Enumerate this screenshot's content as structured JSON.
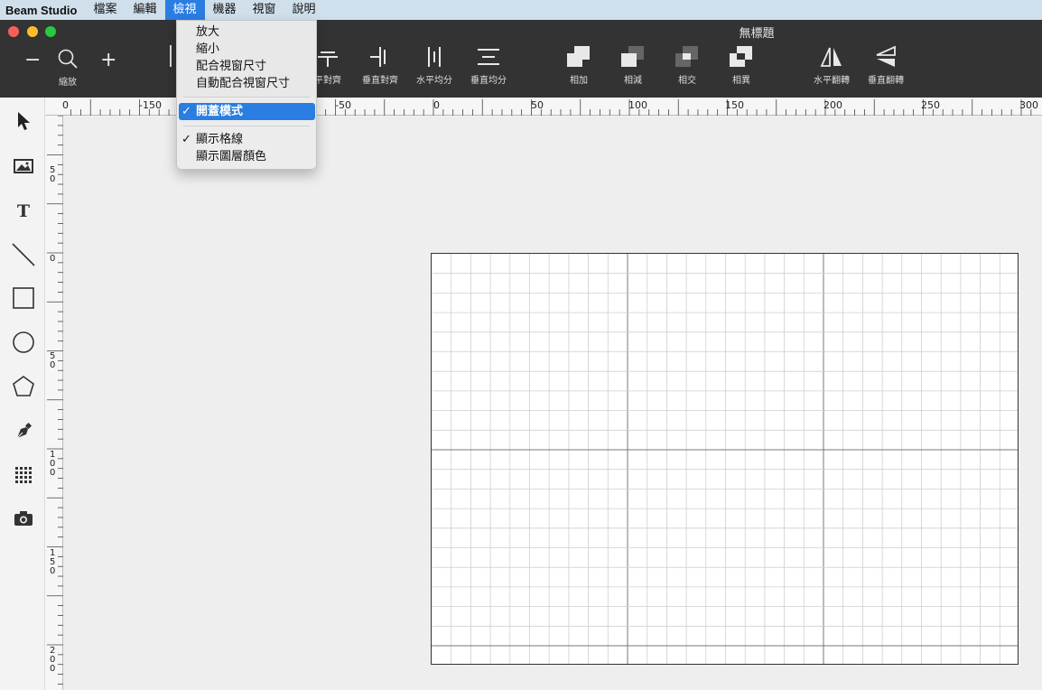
{
  "menubar": {
    "app_name": "Beam Studio",
    "items": [
      "檔案",
      "編輯",
      "檢視",
      "機器",
      "視窗",
      "說明"
    ],
    "active_index": 2
  },
  "window": {
    "title": "無標題"
  },
  "toolbar": {
    "zoom_minus": "−",
    "zoom_plus": "+",
    "zoom_label": "縮放",
    "buttons": [
      {
        "label": "平對齊",
        "icon": "align-horizontal-center-icon"
      },
      {
        "label": "垂直對齊",
        "icon": "align-vertical-center-icon"
      },
      {
        "label": "水平均分",
        "icon": "distribute-horizontal-icon"
      },
      {
        "label": "垂直均分",
        "icon": "distribute-vertical-icon"
      },
      {
        "label": "相加",
        "icon": "union-icon"
      },
      {
        "label": "相減",
        "icon": "subtract-icon"
      },
      {
        "label": "相交",
        "icon": "intersect-icon"
      },
      {
        "label": "相異",
        "icon": "difference-icon"
      },
      {
        "label": "水平翻轉",
        "icon": "flip-horizontal-icon"
      },
      {
        "label": "垂直翻轉",
        "icon": "flip-vertical-icon"
      }
    ]
  },
  "left_tools": [
    "cursor-icon",
    "image-icon",
    "text-icon",
    "line-icon",
    "rectangle-icon",
    "ellipse-icon",
    "polygon-icon",
    "pen-icon",
    "grid-array-icon",
    "camera-icon"
  ],
  "dropdown": {
    "items": [
      {
        "label": "放大",
        "checked": false,
        "highlighted": false
      },
      {
        "label": "縮小",
        "checked": false,
        "highlighted": false
      },
      {
        "label": "配合視窗尺寸",
        "checked": false,
        "highlighted": false
      },
      {
        "label": "自動配合視窗尺寸",
        "checked": false,
        "highlighted": false
      },
      {
        "label": "開蓋模式",
        "checked": true,
        "highlighted": true
      },
      {
        "label": "顯示格線",
        "checked": true,
        "highlighted": false
      },
      {
        "label": "顯示圖層顏色",
        "checked": false,
        "highlighted": false
      }
    ],
    "check_glyph": "✓"
  },
  "ruler_top": {
    "labels": [
      "0",
      "-150",
      "-50",
      "0",
      "50",
      "100",
      "150",
      "200",
      "250",
      "300"
    ]
  },
  "ruler_left": {
    "labels": [
      "50",
      "0",
      "50",
      "100",
      "150",
      "200"
    ]
  },
  "colors": {
    "highlight": "#2a7de1",
    "titlebar": "#333333",
    "menubar": "#cfe0ec"
  }
}
